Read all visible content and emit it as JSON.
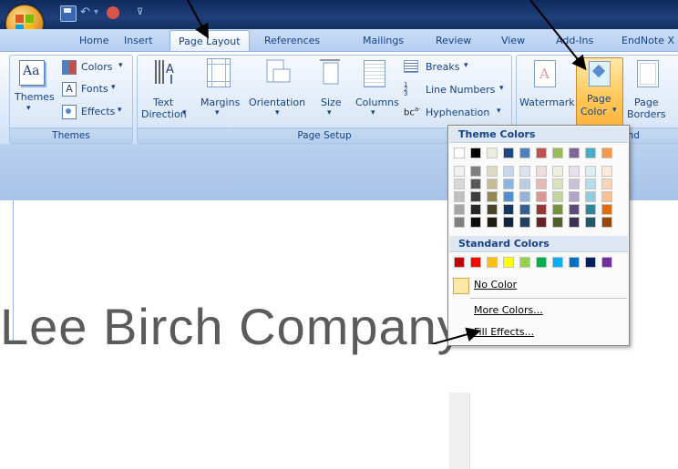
{
  "tabs": [
    "Home",
    "Insert",
    "Page Layout",
    "References",
    "Mailings",
    "Review",
    "View",
    "Add-Ins",
    "EndNote X"
  ],
  "themes_group": {
    "label": "Themes",
    "themes_button": "Themes",
    "colors": "Colors",
    "fonts": "Fonts",
    "effects": "Effects",
    "dropdown_glyph": "▾"
  },
  "page_setup_group": {
    "label": "Page Setup",
    "text_direction": [
      "Text",
      "Direction"
    ],
    "margins": "Margins",
    "orientation": "Orientation",
    "size": "Size",
    "columns": "Columns",
    "breaks": "Breaks",
    "line_numbers": "Line Numbers",
    "hyphenation": "Hyphenation",
    "dropdown_glyph": "▾"
  },
  "page_background_group": {
    "label_visible": "und",
    "watermark": "Watermark",
    "page_color": [
      "Page",
      "Color"
    ],
    "page_borders": [
      "Page",
      "Borders"
    ]
  },
  "page_color_menu": {
    "theme_colors_header": "Theme Colors",
    "standard_colors_header": "Standard Colors",
    "no_color": "No Color",
    "more_colors": "More Colors...",
    "fill_effects": "Fill Effects...",
    "theme_top_row": [
      "#ffffff",
      "#000000",
      "#eeece1",
      "#1f497d",
      "#4f81bd",
      "#c0504d",
      "#9bbb59",
      "#8064a2",
      "#4bacc6",
      "#f79646"
    ],
    "theme_shades": [
      [
        "#f2f2f2",
        "#7f7f7f",
        "#ddd9c3",
        "#c6d9f0",
        "#dbe5f1",
        "#f2dcdb",
        "#ebf1dd",
        "#e5e0ec",
        "#dbeef3",
        "#fdeada"
      ],
      [
        "#d8d8d8",
        "#595959",
        "#c4bd97",
        "#8db3e2",
        "#b8cce4",
        "#e5b9b7",
        "#d7e3bc",
        "#ccc1d9",
        "#b7dde8",
        "#fbd5b5"
      ],
      [
        "#bfbfbf",
        "#3f3f3f",
        "#938953",
        "#548dd4",
        "#95b3d7",
        "#d99694",
        "#c3d69b",
        "#b2a2c7",
        "#92cddc",
        "#fac08f"
      ],
      [
        "#a5a5a5",
        "#262626",
        "#494429",
        "#17365d",
        "#366092",
        "#953734",
        "#76923c",
        "#5f497a",
        "#31859b",
        "#e36c09"
      ],
      [
        "#7f7f7f",
        "#0c0c0c",
        "#1d1b10",
        "#0f243e",
        "#244061",
        "#632423",
        "#4f6128",
        "#3f3151",
        "#205867",
        "#974806"
      ]
    ],
    "standard": [
      "#c00000",
      "#ff0000",
      "#ffc000",
      "#ffff00",
      "#92d050",
      "#00b050",
      "#00b0f0",
      "#0070c0",
      "#002060",
      "#7030a0"
    ]
  },
  "document_heading": "Lee Birch Company"
}
